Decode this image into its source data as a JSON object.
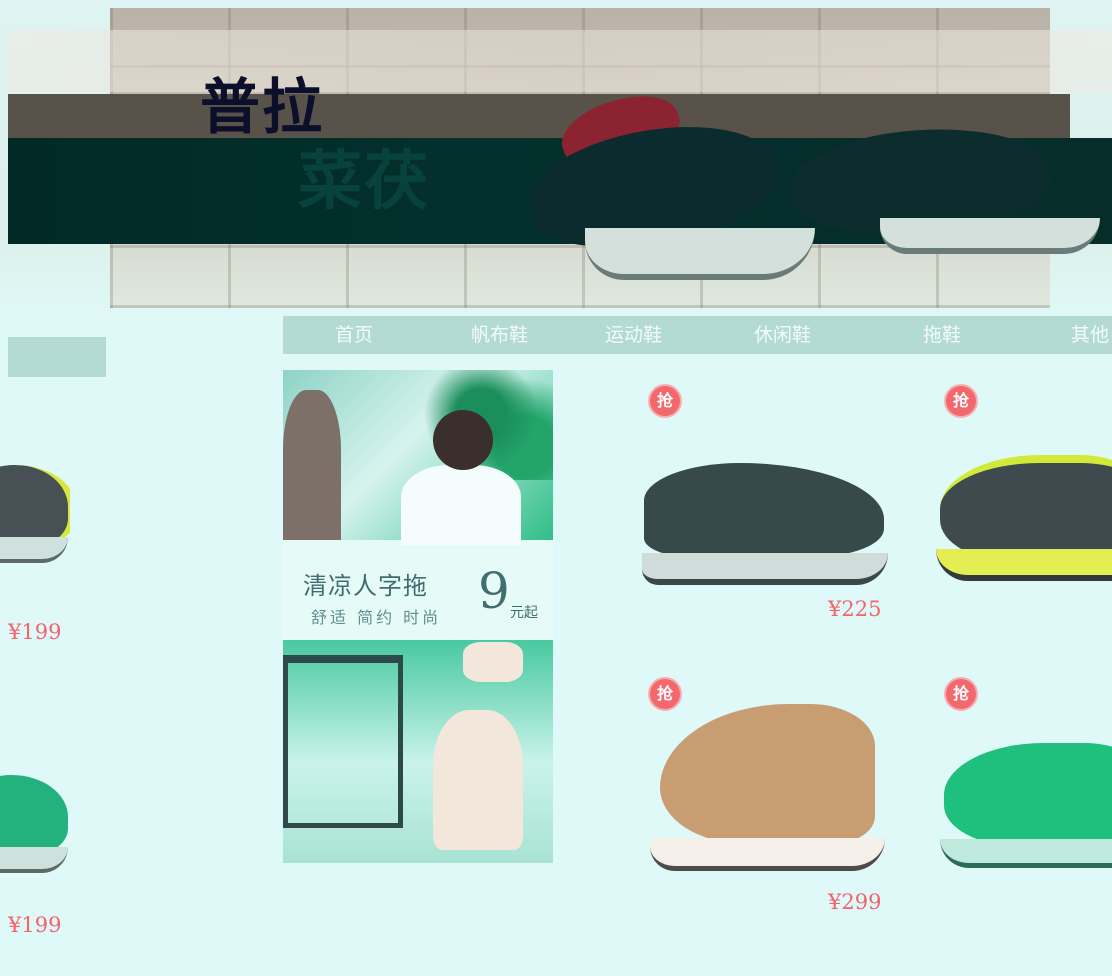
{
  "banner": {
    "title_line1": "普拉",
    "title_line2": "菜茯"
  },
  "nav": {
    "items": [
      {
        "label": "首页"
      },
      {
        "label": "帆布鞋"
      },
      {
        "label": "运动鞋"
      },
      {
        "label": "休闲鞋"
      },
      {
        "label": "拖鞋"
      },
      {
        "label": "其他"
      }
    ]
  },
  "promo": {
    "title": "清凉人字拖",
    "subtitle": "舒适 简约 时尚",
    "price_number": "9",
    "price_suffix": "元起"
  },
  "badge_text": "抢",
  "products": [
    {
      "price": "¥225",
      "icon": "casual-shoe-icon"
    },
    {
      "price": "",
      "icon": "sneaker-icon"
    },
    {
      "price": "¥299",
      "icon": "high-top-shoe-icon"
    },
    {
      "price": "",
      "icon": "green-sneaker-icon"
    }
  ],
  "left_products": [
    {
      "price": "¥199"
    },
    {
      "price": "¥199"
    }
  ],
  "colors": {
    "page_background": "#dff9f8",
    "nav_background": "#b4dbd3",
    "price": "#f3646a",
    "badge": "#f2686d"
  }
}
